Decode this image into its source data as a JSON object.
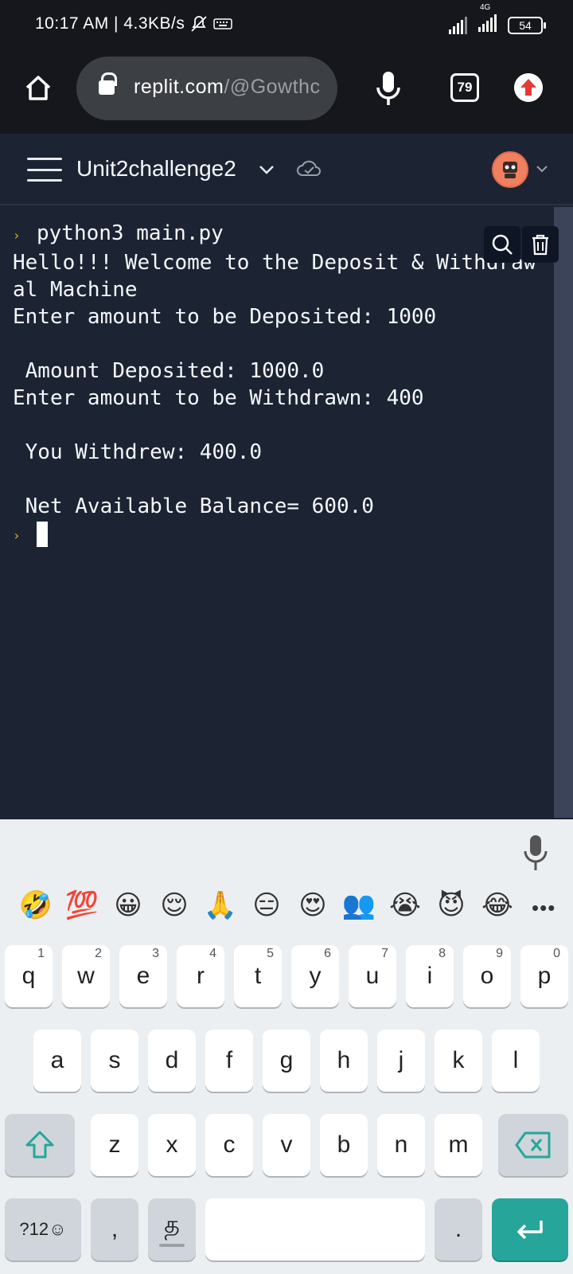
{
  "status": {
    "time": "10:17 AM | 4.3KB/s",
    "net_type": "4G",
    "battery": "54"
  },
  "browser": {
    "url_host": "replit.com",
    "url_rest": "/@Gowthc",
    "tab_count": "79"
  },
  "app": {
    "project_name": "Unit2challenge2"
  },
  "console": {
    "lines": [
      "python3 main.py",
      "Hello!!! Welcome to the Deposit & Withdraw",
      "al Machine",
      "Enter amount to be Deposited: 1000",
      "",
      " Amount Deposited: 1000.0",
      "Enter amount to be Withdrawn: 400",
      "",
      " You Withdrew: 400.0",
      "",
      " Net Available Balance= 600.0"
    ]
  },
  "keyboard": {
    "emojis": [
      "🤣",
      "💯",
      "😀",
      "😌",
      "🙏",
      "😑",
      "😍",
      "👥",
      "😭",
      "😈",
      "😂"
    ],
    "more": "•••",
    "row1": [
      {
        "k": "q",
        "n": "1"
      },
      {
        "k": "w",
        "n": "2"
      },
      {
        "k": "e",
        "n": "3"
      },
      {
        "k": "r",
        "n": "4"
      },
      {
        "k": "t",
        "n": "5"
      },
      {
        "k": "y",
        "n": "6"
      },
      {
        "k": "u",
        "n": "7"
      },
      {
        "k": "i",
        "n": "8"
      },
      {
        "k": "o",
        "n": "9"
      },
      {
        "k": "p",
        "n": "0"
      }
    ],
    "row2": [
      "a",
      "s",
      "d",
      "f",
      "g",
      "h",
      "j",
      "k",
      "l"
    ],
    "row3": [
      "z",
      "x",
      "c",
      "v",
      "b",
      "n",
      "m"
    ],
    "symbols_label": "?12☺",
    "comma": ",",
    "lang_label": "த",
    "period": ".",
    "accent_color": "#26a69a"
  }
}
